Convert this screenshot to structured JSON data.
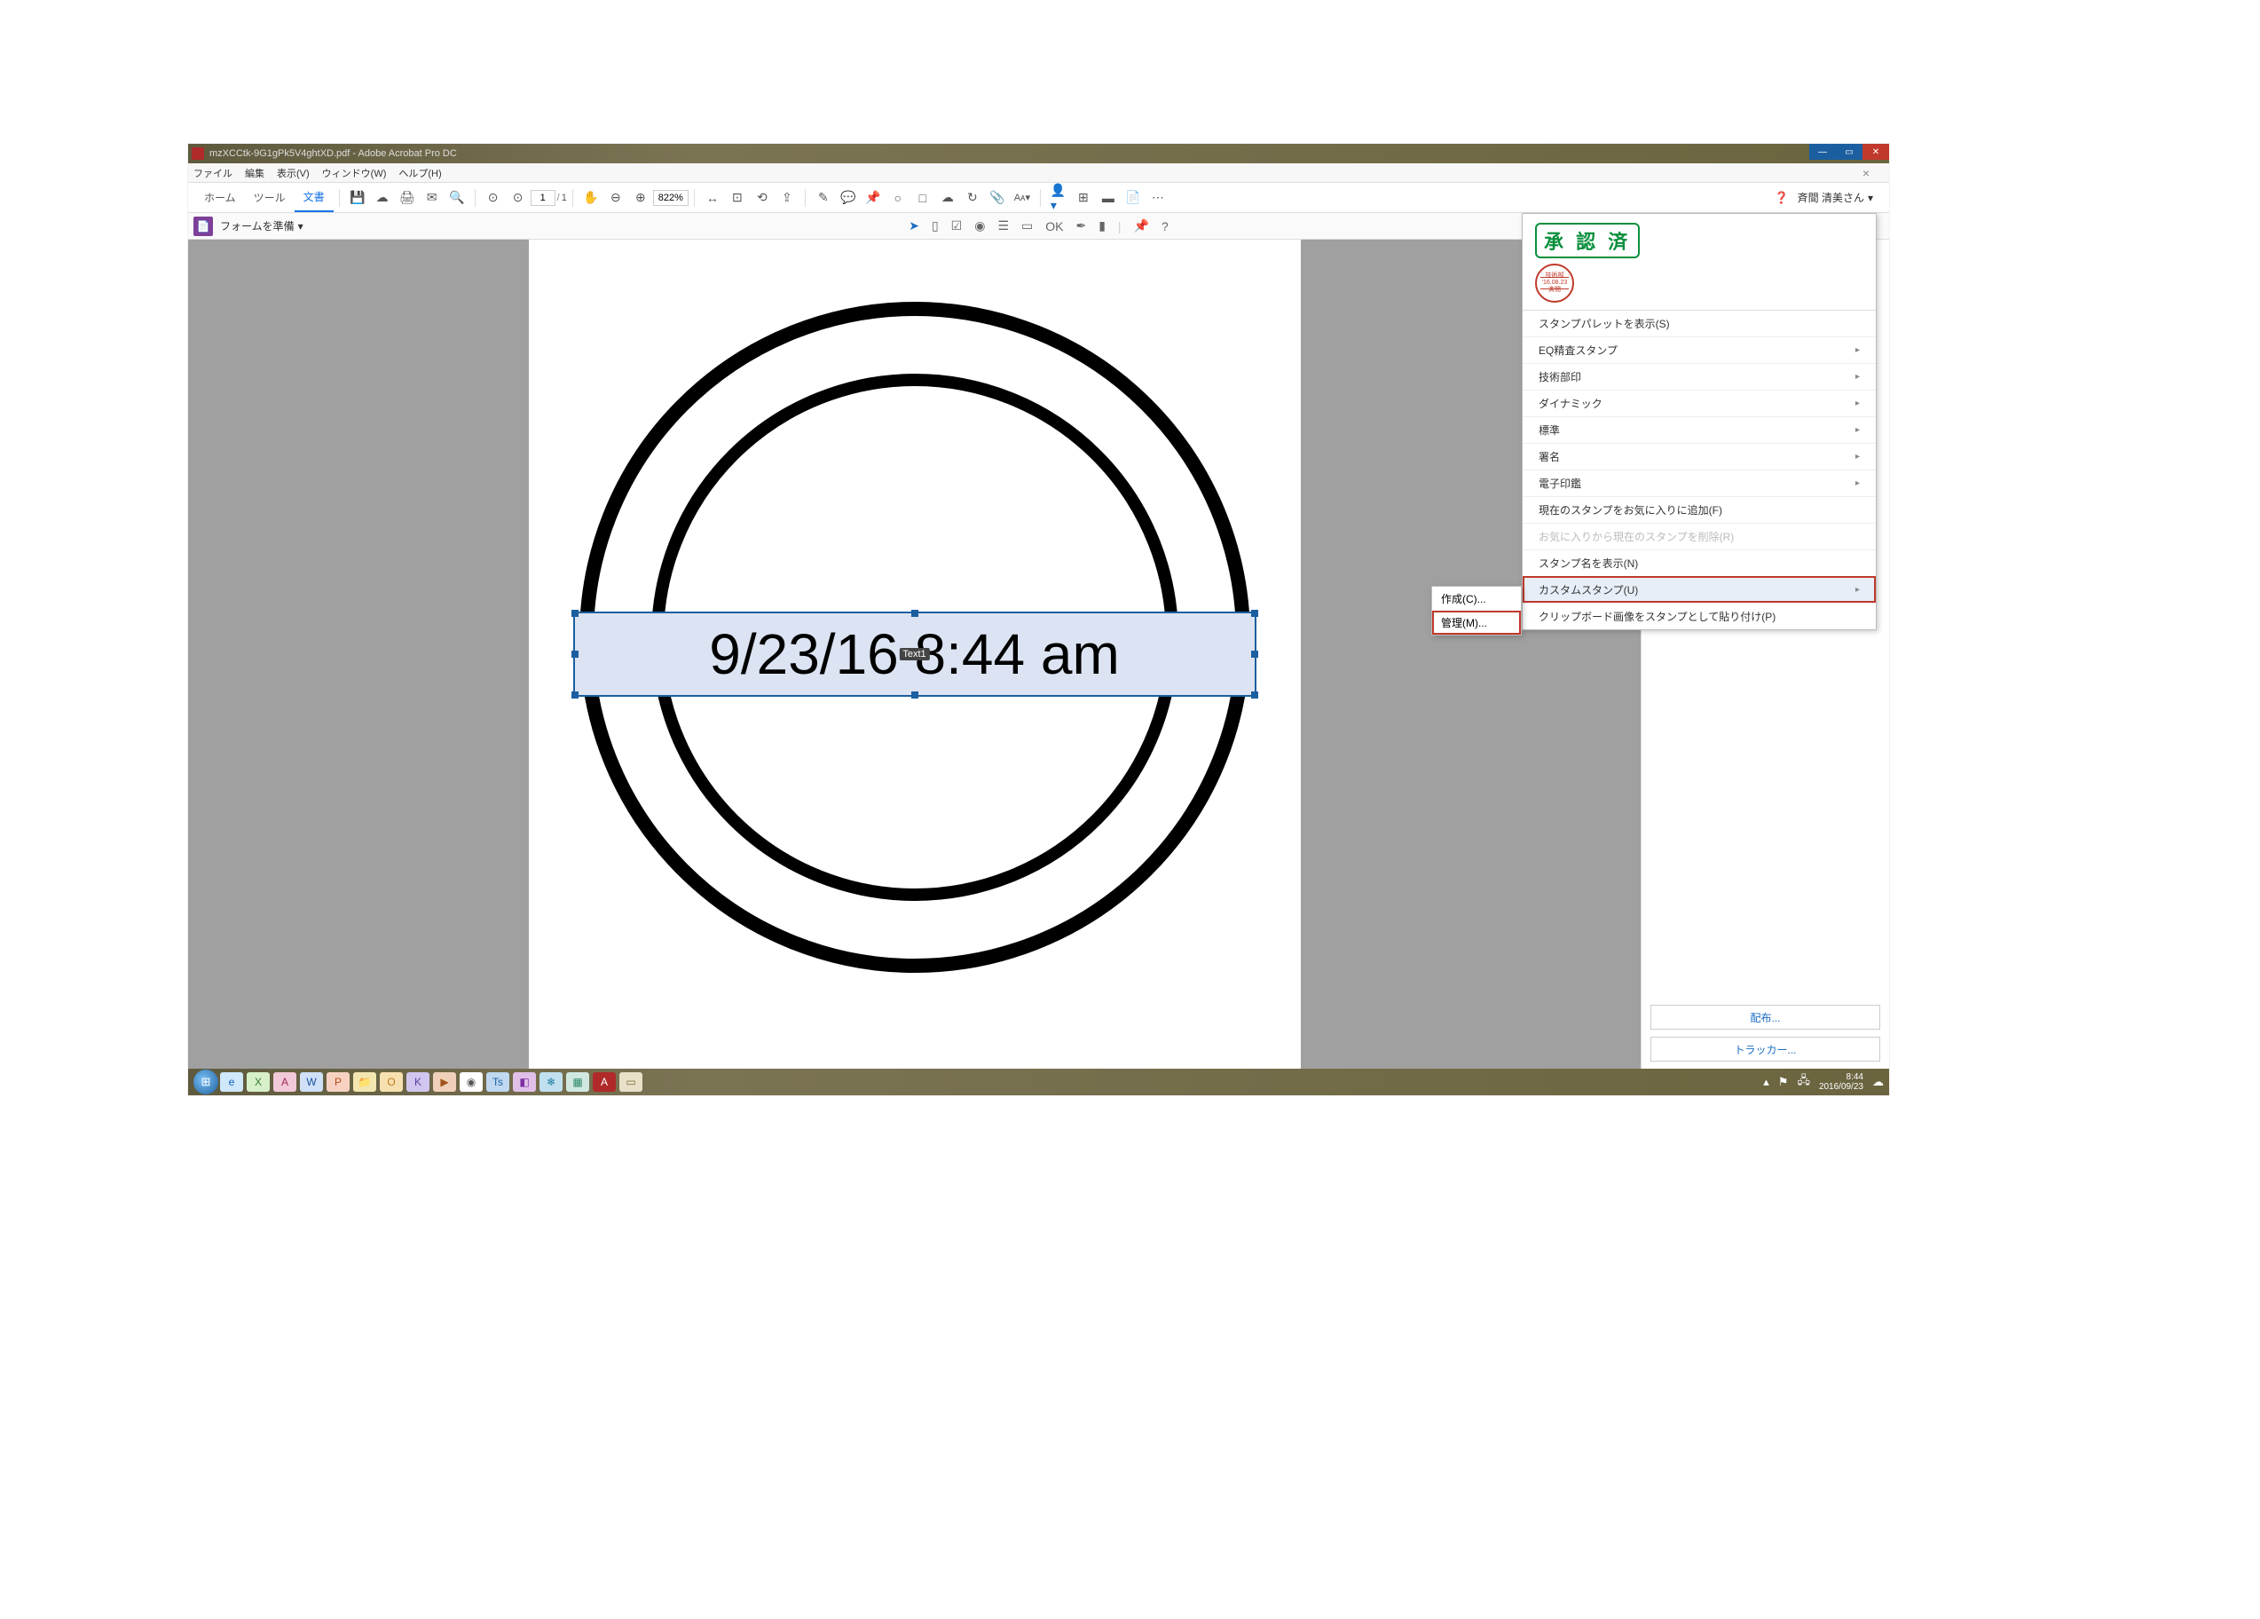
{
  "titlebar": {
    "filename": "mzXCCtk-9G1gPk5V4ghtXD.pdf - Adobe Acrobat Pro DC"
  },
  "menubar": {
    "file": "ファイル",
    "edit": "編集",
    "view": "表示(V)",
    "window": "ウィンドウ(W)",
    "help": "ヘルプ(H)"
  },
  "maintabs": {
    "home": "ホーム",
    "tools": "ツール",
    "document": "文書"
  },
  "page_nav": {
    "current": "1",
    "total": "1"
  },
  "zoom": {
    "value": "822%"
  },
  "user": {
    "name": "斉間 清美さん",
    "caret": "▾"
  },
  "subbar": {
    "prepare_form": "フォームを準備",
    "caret": "▾"
  },
  "canvas": {
    "date_text": "9/23/16  8:44 am",
    "field_tag": "Text1"
  },
  "stamp_panel": {
    "approved": "承 認 済",
    "seal_top": "技術部",
    "seal_mid": "'16.08.23",
    "seal_bot": "斉間",
    "items": {
      "show_palette": "スタンプパレットを表示(S)",
      "eq_review": "EQ精査スタンプ",
      "tech_seal": "技術部印",
      "dynamic": "ダイナミック",
      "standard": "標準",
      "signature": "署名",
      "eseal": "電子印鑑",
      "add_fav": "現在のスタンプをお気に入りに追加(F)",
      "remove_fav": "お気に入りから現在のスタンプを削除(R)",
      "show_names": "スタンプ名を表示(N)",
      "custom": "カスタムスタンプ(U)",
      "paste_clip": "クリップボード画像をスタンプとして貼り付け(P)"
    }
  },
  "submenu": {
    "create": "作成(C)...",
    "manage": "管理(M)..."
  },
  "rightrail": {
    "distribute": "配布...",
    "tracker": "トラッカー..."
  },
  "taskbar": {
    "time": "8:44",
    "date": "2016/09/23"
  }
}
